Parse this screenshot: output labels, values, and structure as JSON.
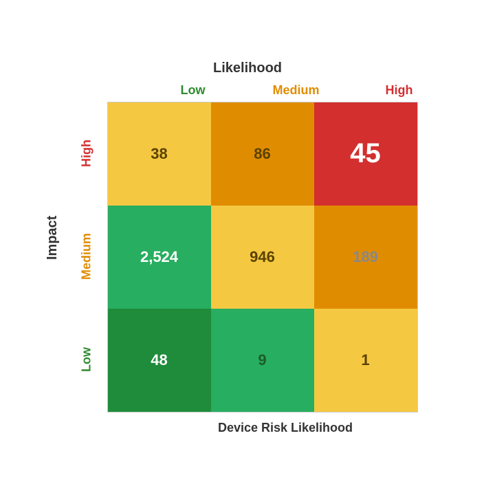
{
  "chart": {
    "top_title": "Likelihood",
    "bottom_title": "Device Risk Likelihood",
    "y_axis_label": "Impact",
    "col_headers": [
      {
        "label": "Low",
        "color": "#2e8b2e"
      },
      {
        "label": "Medium",
        "color": "#e08c00"
      },
      {
        "label": "High",
        "color": "#d32f2f"
      }
    ],
    "row_labels": [
      {
        "label": "High",
        "color": "#d32f2f"
      },
      {
        "label": "Medium",
        "color": "#e08c00"
      },
      {
        "label": "Low",
        "color": "#2e8b2e"
      }
    ],
    "cells": [
      {
        "row": 0,
        "col": 0,
        "value": "38",
        "bg": "#f5c842",
        "text_color": "#5a4200",
        "font_size": "22px"
      },
      {
        "row": 0,
        "col": 1,
        "value": "86",
        "bg": "#e08c00",
        "text_color": "#5a4200",
        "font_size": "22px"
      },
      {
        "row": 0,
        "col": 2,
        "value": "45",
        "bg": "#d32f2f",
        "text_color": "#ffffff",
        "font_size": "40px"
      },
      {
        "row": 1,
        "col": 0,
        "value": "2,524",
        "bg": "#27ae60",
        "text_color": "#ffffff",
        "font_size": "22px"
      },
      {
        "row": 1,
        "col": 1,
        "value": "946",
        "bg": "#f5c842",
        "text_color": "#5a4200",
        "font_size": "22px"
      },
      {
        "row": 1,
        "col": 2,
        "value": "189",
        "bg": "#e08c00",
        "text_color": "#888",
        "font_size": "22px"
      },
      {
        "row": 2,
        "col": 0,
        "value": "48",
        "bg": "#1e8c3a",
        "text_color": "#ffffff",
        "font_size": "22px"
      },
      {
        "row": 2,
        "col": 1,
        "value": "9",
        "bg": "#27ae60",
        "text_color": "#1e5c2a",
        "font_size": "22px"
      },
      {
        "row": 2,
        "col": 2,
        "value": "1",
        "bg": "#f5c842",
        "text_color": "#5a4200",
        "font_size": "22px"
      }
    ]
  }
}
